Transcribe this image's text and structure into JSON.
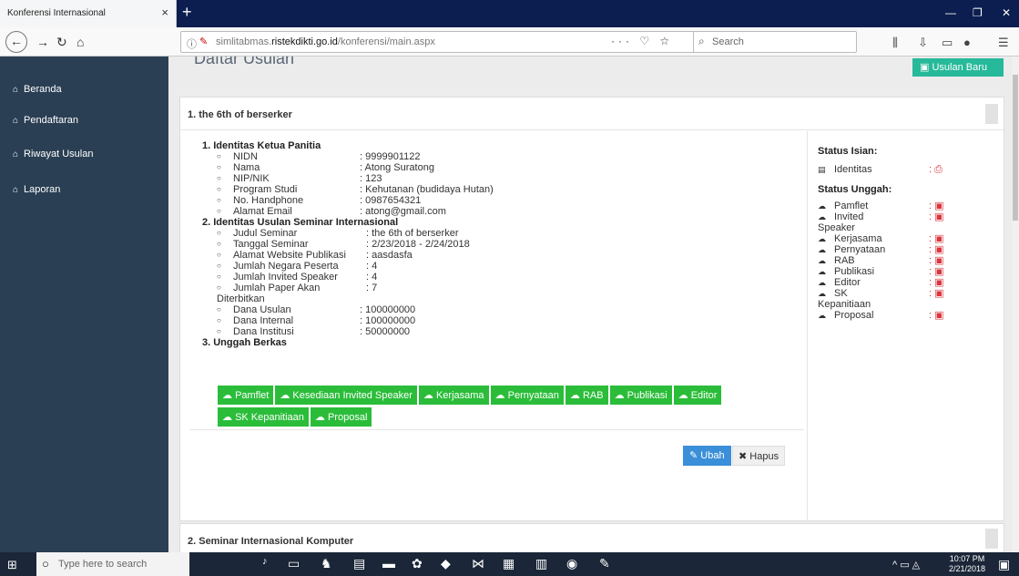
{
  "browser": {
    "tab_title": "Konferensi Internasional",
    "tab_close": "×",
    "new_tab": "+",
    "url_host": "simlitabmas.ristekdikti.go.id",
    "url_path": "/konferensi/main.aspx",
    "url_prefix": "simlitabmas.",
    "url_domain": "ristekdikti.go.id",
    "search_placeholder": "Search",
    "url_actions": "··· ♡ ☆"
  },
  "sidebar": {
    "items": [
      {
        "label": "Beranda",
        "icon": "home-icon"
      },
      {
        "label": "Pendaftaran",
        "icon": "home-icon"
      },
      {
        "label": "Riwayat Usulan",
        "icon": "home-icon"
      },
      {
        "label": "Laporan",
        "icon": "home-icon"
      }
    ]
  },
  "main": {
    "title": "Daftar Usulan",
    "new_button": "Usulan Baru",
    "proposal1": {
      "header": "1. the 6th of berserker",
      "sec1": "1. Identitas Ketua Panitia",
      "identitas": [
        {
          "k": "NIDN",
          "v": ": 9999901122"
        },
        {
          "k": "Nama",
          "v": ": Atong Suratong"
        },
        {
          "k": "NIP/NIK",
          "v": ": 123"
        },
        {
          "k": "Program Studi",
          "v": ": Kehutanan (budidaya Hutan)"
        },
        {
          "k": "No. Handphone",
          "v": ": 0987654321"
        },
        {
          "k": "Alamat Email",
          "v": ": atong@gmail.com"
        }
      ],
      "sec2": "2. Identitas Usulan Seminar Internasional",
      "usulan": [
        {
          "k": "Judul Seminar",
          "v": ": the 6th of berserker"
        },
        {
          "k": "Tanggal Seminar",
          "v": ": 2/23/2018 - 2/24/2018"
        },
        {
          "k": "Alamat Website Publikasi",
          "v": ": aasdasfa"
        },
        {
          "k": "Jumlah Negara Peserta",
          "v": ": 4"
        },
        {
          "k": "Jumlah Invited Speaker",
          "v": ": 4"
        },
        {
          "k": "Jumlah Paper Akan",
          "v": ": 7"
        }
      ],
      "diterbitkan": "Diterbitkan",
      "dana": [
        {
          "k": "Dana Usulan",
          "v": ": 100000000"
        },
        {
          "k": "Dana Internal",
          "v": ": 100000000"
        },
        {
          "k": "Dana Institusi",
          "v": ": 50000000"
        }
      ],
      "sec3": "3. Unggah Berkas",
      "upload_buttons": [
        "Pamflet",
        "Kesediaan Invited Speaker",
        "Kerjasama",
        "Pernyataan",
        "RAB",
        "Publikasi",
        "Editor",
        "SK Kepanitiaan",
        "Proposal"
      ],
      "ubah": "Ubah",
      "hapus": "Hapus",
      "status_isian_title": "Status Isian:",
      "status_isian": [
        {
          "k": "Identitas",
          "v": ":"
        }
      ],
      "status_unggah_title": "Status Unggah:",
      "status_unggah": [
        {
          "k": "Pamflet",
          "v": ":"
        },
        {
          "k": "Invited",
          "v": ":"
        },
        {
          "k": "Speaker",
          "v": "",
          "note": true
        },
        {
          "k": "Kerjasama",
          "v": ":"
        },
        {
          "k": "Pernyataan",
          "v": ":"
        },
        {
          "k": "RAB",
          "v": ":"
        },
        {
          "k": "Publikasi",
          "v": ":"
        },
        {
          "k": "Editor",
          "v": ":"
        },
        {
          "k": "SK",
          "v": ":"
        },
        {
          "k": "Kepanitiaan",
          "v": "",
          "note": true
        },
        {
          "k": "Proposal",
          "v": ":"
        }
      ]
    },
    "proposal2": {
      "header": "2. Seminar Internasional Komputer"
    }
  },
  "taskbar": {
    "search_placeholder": "Type here to search",
    "time": "10:07 PM",
    "date": "2/21/2018"
  }
}
